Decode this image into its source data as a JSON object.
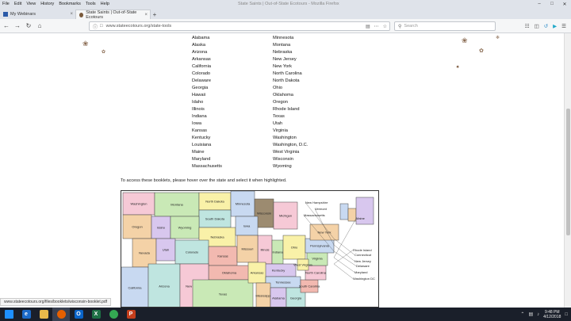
{
  "browser": {
    "menu": [
      "File",
      "Edit",
      "View",
      "History",
      "Bookmarks",
      "Tools",
      "Help"
    ],
    "window_title": "State Saints | Out-of-State Ecotours - Mozilla Firefox",
    "tabs": [
      {
        "label": "My Webinars",
        "active": false
      },
      {
        "label": "State Saints | Out-of-State Ecotours",
        "active": true
      }
    ],
    "url": "www.stateecotours.org/state-tools",
    "search_placeholder": "Search"
  },
  "page": {
    "states_left": [
      "Alabama",
      "Alaska",
      "Arizona",
      "Arkansas",
      "California",
      "Colorado",
      "Delaware",
      "Georgia",
      "Hawaii",
      "Idaho",
      "Illinois",
      "Indiana",
      "Iowa",
      "Kansas",
      "Kentucky",
      "Louisiana",
      "Maine",
      "Maryland",
      "Massachusetts"
    ],
    "states_right": [
      "Minnesota",
      "Montana",
      "Nebraska",
      "New Jersey",
      "New York",
      "North Carolina",
      "North Dakota",
      "Ohio",
      "Oklahoma",
      "Oregon",
      "Rhode Island",
      "Texas",
      "Utah",
      "Virginia",
      "Washington",
      "Washington, D.C.",
      "West Virginia",
      "Wisconsin",
      "Wyoming"
    ],
    "instruction": "To access these booklets, please hover over the state and select it when highlighted.",
    "map": {
      "west_labels": [
        "Washington",
        "Montana",
        "North Dakota",
        "Minnesota",
        "Oregon",
        "Idaho",
        "South Dakota",
        "Wisconsin",
        "Michigan",
        "Wyoming",
        "Nebraska",
        "Iowa",
        "Nevada",
        "Utah",
        "Colorado",
        "Kansas",
        "Illinois",
        "Indiana",
        "Ohio",
        "California",
        "Missouri",
        "Kentucky",
        "Arizona",
        "Oklahoma",
        "New Mexico",
        "Texas",
        "Arkansas",
        "Tennessee",
        "Mississippi",
        "Alabama",
        "Georgia",
        "South Carolina",
        "North Carolina",
        "Virginia",
        "West Virginia",
        "Pennsylvania",
        "New York"
      ],
      "east_labels": [
        "New Hampshire",
        "Vermont",
        "Massachusetts",
        "Maine",
        "Rhode Island",
        "Connecticut",
        "New Jersey",
        "Delaware",
        "Maryland",
        "Washington DC"
      ]
    },
    "status_link": "www.stateecotours.org/files/booklets/wisconsin-booklet.pdf"
  },
  "taskbar": {
    "apps": [
      {
        "name": "windows-start",
        "glyph": "",
        "color": "#1e90ff"
      },
      {
        "name": "internet-explorer",
        "glyph": "e",
        "color": "#1b6ac9"
      },
      {
        "name": "file-explorer",
        "glyph": "",
        "color": "#e8b84a"
      },
      {
        "name": "firefox",
        "glyph": "",
        "color": "#e66000"
      },
      {
        "name": "outlook",
        "glyph": "O",
        "color": "#0a64c8"
      },
      {
        "name": "excel",
        "glyph": "X",
        "color": "#1d7044"
      },
      {
        "name": "chrome",
        "glyph": "",
        "color": "#34a853"
      },
      {
        "name": "powerpoint",
        "glyph": "P",
        "color": "#c43e1c"
      }
    ],
    "time": "9:48 PM",
    "date": "4/12/2018"
  },
  "colors": {
    "wisconsin_highlight": "#9c8b70",
    "map_palette": [
      "#f6c9d6",
      "#c9e9b6",
      "#f9f1a8",
      "#c8d9f1",
      "#f4d2a7",
      "#d8c7ee",
      "#bfe5e0",
      "#f2b9b0"
    ]
  }
}
